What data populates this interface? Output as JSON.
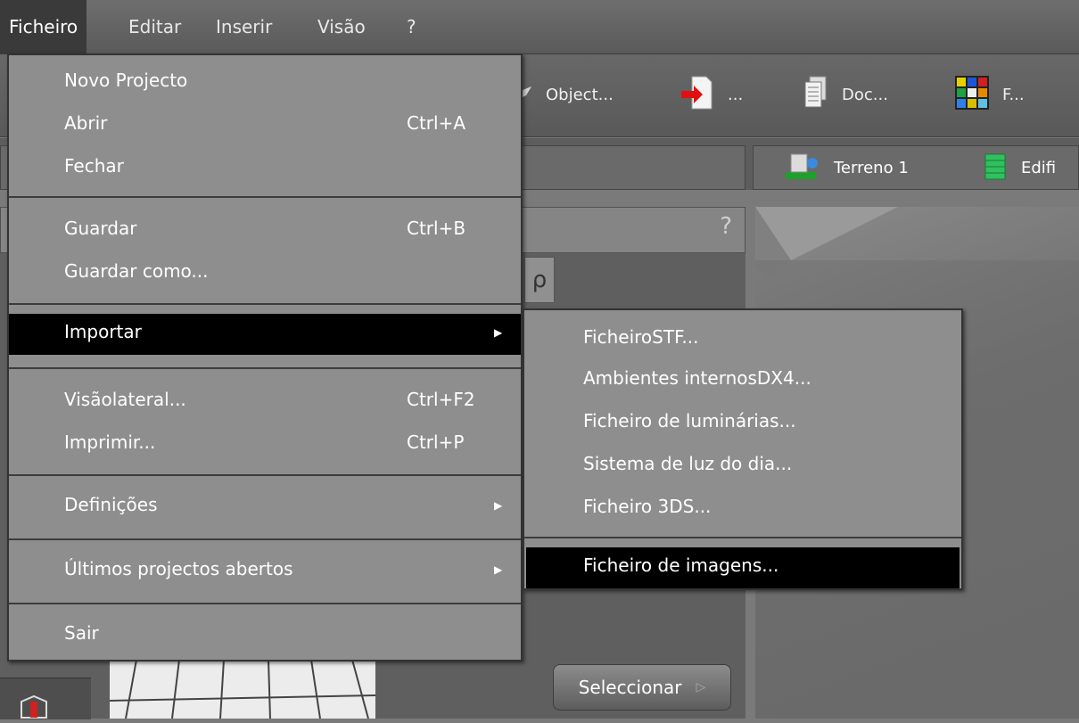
{
  "menubar": {
    "items": [
      "Ficheiro",
      "Editar",
      "Inserir",
      "Visão",
      "?"
    ]
  },
  "toolbar": {
    "items": [
      {
        "label": "Object...",
        "icon": "pencil-icon"
      },
      {
        "label": "...",
        "icon": "import-arrow-icon"
      },
      {
        "label": "Doc...",
        "icon": "document-icon"
      },
      {
        "label": "F...",
        "icon": "color-grid-icon"
      }
    ]
  },
  "tabs": {
    "terrain": "Terreno 1",
    "building": "Edifi"
  },
  "panel": {
    "help": "?",
    "rho": "ρ"
  },
  "file_menu": {
    "items": [
      {
        "label": "Novo Projecto",
        "shortcut": ""
      },
      {
        "label": "Abrir",
        "shortcut": "Ctrl+A"
      },
      {
        "label": "Fechar",
        "shortcut": ""
      },
      {
        "label": "Guardar",
        "shortcut": "Ctrl+B"
      },
      {
        "label": "Guardar como...",
        "shortcut": ""
      },
      {
        "label": "Importar",
        "shortcut": ""
      },
      {
        "label": "Visãolateral...",
        "shortcut": "Ctrl+F2"
      },
      {
        "label": "Imprimir...",
        "shortcut": "Ctrl+P"
      },
      {
        "label": "Definições",
        "shortcut": ""
      },
      {
        "label": "Últimos projectos abertos",
        "shortcut": ""
      },
      {
        "label": "Sair",
        "shortcut": ""
      }
    ]
  },
  "import_submenu": {
    "items": [
      "FicheiroSTF...",
      "Ambientes internosDX4...",
      "Ficheiro de luminárias...",
      "Sistema de luz do dia...",
      "Ficheiro 3DS...",
      "Ficheiro de imagens..."
    ]
  },
  "bottom": {
    "select_button": "Seleccionar"
  },
  "colors": {
    "menu_bg": "#8e8e8e",
    "highlight": "#000000",
    "menubar_bg": "#5a5a5a"
  }
}
